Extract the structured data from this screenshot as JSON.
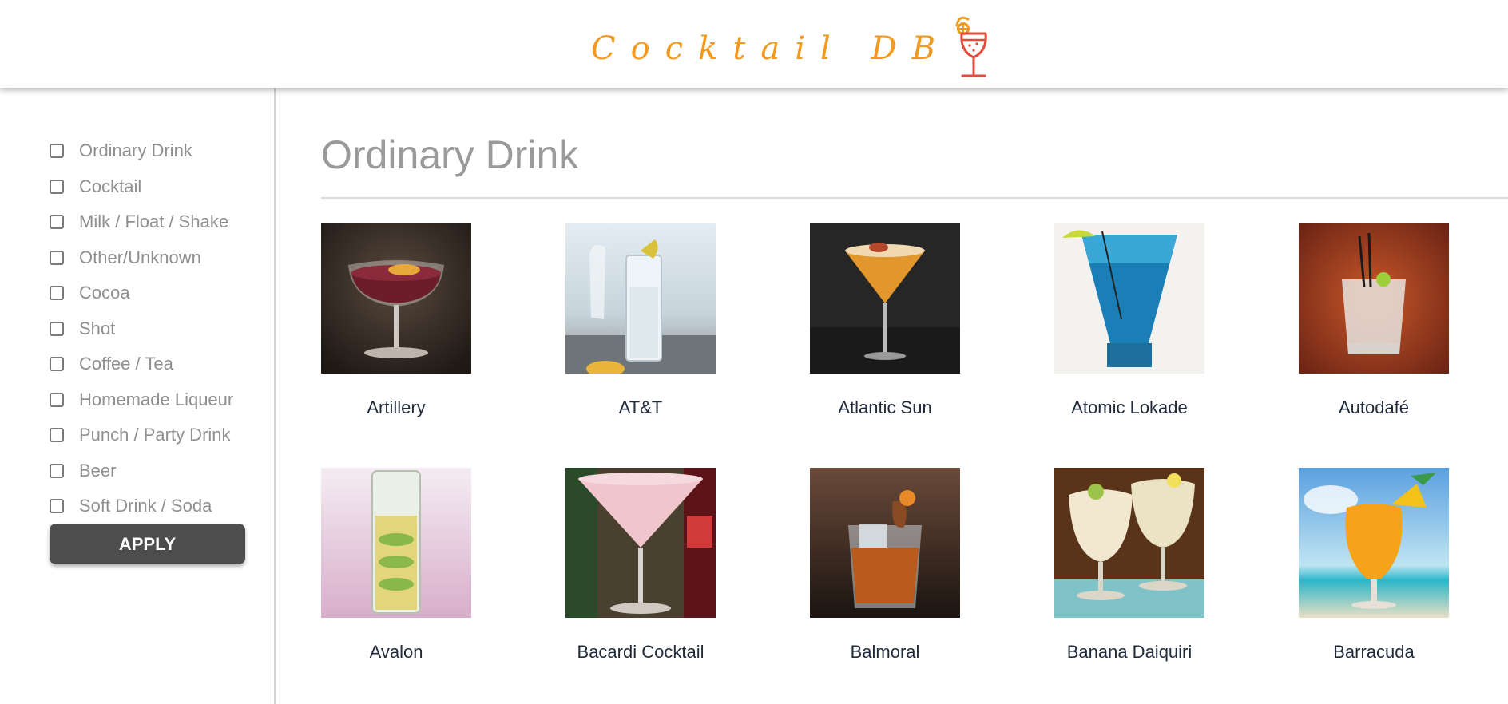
{
  "header": {
    "logo_text": "Cocktail DB",
    "logo_icon": "cocktail-glass-icon",
    "accent_color": "#f19a1f",
    "glass_color": "#e8483a"
  },
  "sidebar": {
    "categories": [
      {
        "label": "Ordinary Drink",
        "checked": false
      },
      {
        "label": "Cocktail",
        "checked": false
      },
      {
        "label": "Milk / Float / Shake",
        "checked": false
      },
      {
        "label": "Other/Unknown",
        "checked": false
      },
      {
        "label": "Cocoa",
        "checked": false
      },
      {
        "label": "Shot",
        "checked": false
      },
      {
        "label": "Coffee / Tea",
        "checked": false
      },
      {
        "label": "Homemade Liqueur",
        "checked": false
      },
      {
        "label": "Punch / Party Drink",
        "checked": false
      },
      {
        "label": "Beer",
        "checked": false
      },
      {
        "label": "Soft Drink / Soda",
        "checked": false
      }
    ],
    "apply_label": "APPLY"
  },
  "main": {
    "title": "Ordinary Drink",
    "drinks": [
      {
        "name": "Artillery",
        "image": "drink-photo-coupe-red"
      },
      {
        "name": "AT&T",
        "image": "drink-photo-highball-clear"
      },
      {
        "name": "Atlantic Sun",
        "image": "drink-photo-martini-orange"
      },
      {
        "name": "Atomic Lokade",
        "image": "drink-photo-blue-cocktail"
      },
      {
        "name": "Autodafé",
        "image": "drink-photo-rocks-clear"
      },
      {
        "name": "Avalon",
        "image": "drink-photo-cucumber-highball"
      },
      {
        "name": "Bacardi Cocktail",
        "image": "drink-photo-pink-martini"
      },
      {
        "name": "Balmoral",
        "image": "drink-photo-old-fashioned"
      },
      {
        "name": "Banana Daiquiri",
        "image": "drink-photo-frozen-daiquiri"
      },
      {
        "name": "Barracuda",
        "image": "drink-photo-tropical-orange"
      }
    ]
  }
}
